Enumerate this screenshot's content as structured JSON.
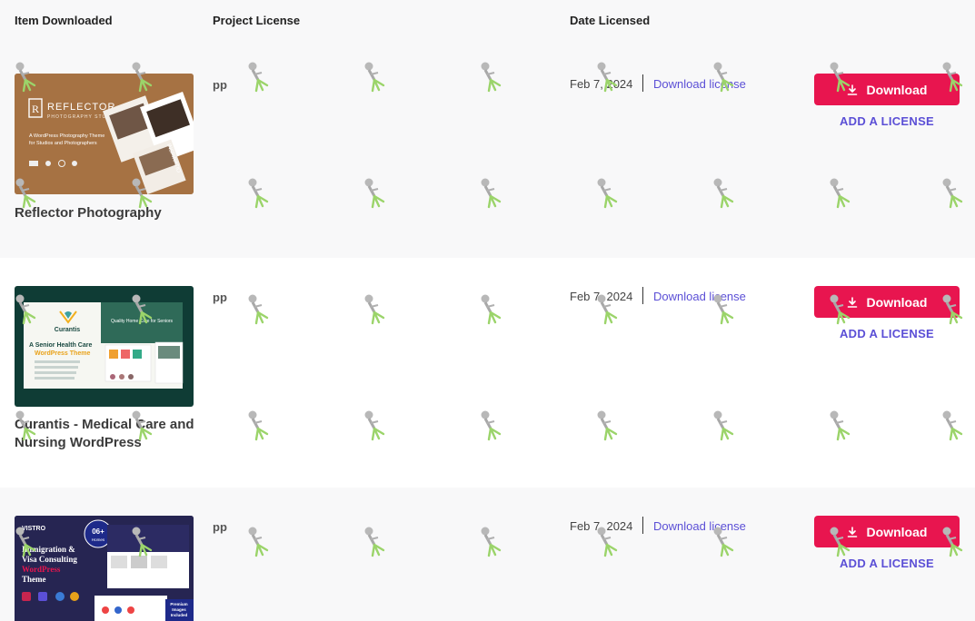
{
  "header": {
    "item_col": "Item Downloaded",
    "license_col": "Project License",
    "date_col": "Date Licensed"
  },
  "rows": [
    {
      "name": "Reflector Photography",
      "license": "pp",
      "date": "Feb 7, 2024",
      "download_license": "Download license",
      "download": "Download",
      "add_license": "ADD A LICENSE",
      "thumb": {
        "brand": "REFLECTOR",
        "tagline": "PHOTOGRAPHY STUDIO",
        "desc1": "A WordPress Photography Theme",
        "desc2": "for Studios and Photographers"
      }
    },
    {
      "name": "Curantis - Medical Care and Nursing WordPress",
      "license": "pp",
      "date": "Feb 7, 2024",
      "download_license": "Download license",
      "download": "Download",
      "add_license": "ADD A LICENSE",
      "thumb": {
        "brand": "Curantis",
        "line1": "A Senior Health Care",
        "line2": "WordPress Theme",
        "hero": "Quality Home Care for Seniors"
      }
    },
    {
      "name": "",
      "license": "pp",
      "date": "Feb 7, 2024",
      "download_license": "Download license",
      "download": "Download",
      "add_license": "ADD A LICENSE",
      "thumb": {
        "brand": "VISTRO",
        "badge_num": "06+",
        "badge_word": "Homes",
        "l1": "Immigration &",
        "l2": "Visa Consulting",
        "l3": "WordPress",
        "l4": "Theme",
        "corner1": "Premium",
        "corner2": "Images",
        "corner3": "Included"
      }
    }
  ],
  "colors": {
    "accent_pink": "#e8154f",
    "link_purple": "#5b4fd6",
    "row_alt": "#f8f8f9"
  }
}
